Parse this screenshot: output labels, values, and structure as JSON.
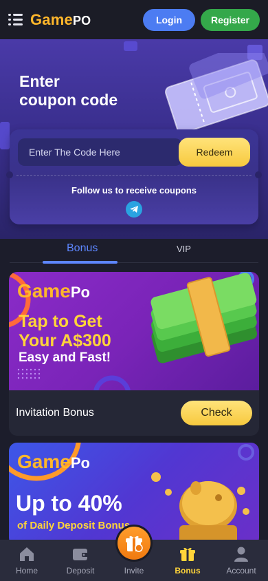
{
  "header": {
    "logo_game": "Game",
    "logo_po": "PO",
    "login_label": "Login",
    "register_label": "Register"
  },
  "hero": {
    "title_line1": "Enter",
    "title_line2": "coupon code"
  },
  "coupon": {
    "placeholder": "Enter The Code Here",
    "redeem_label": "Redeem",
    "follow_text": "Follow us to receive coupons"
  },
  "tabs": [
    {
      "label": "Bonus",
      "active": true
    },
    {
      "label": "VIP",
      "active": false
    }
  ],
  "promos": [
    {
      "logo_game": "Game",
      "logo_po": "Po",
      "line1": "Tap to Get",
      "line2": "Your A$300",
      "line3": "Easy and Fast!",
      "title": "Invitation Bonus",
      "button": "Check"
    },
    {
      "logo_game": "Game",
      "logo_po": "Po",
      "line1": "Up to 40%",
      "line2": "of Daily Deposit Bonus"
    }
  ],
  "nav": [
    {
      "label": "Home",
      "icon": "home-icon"
    },
    {
      "label": "Deposit",
      "icon": "wallet-icon"
    },
    {
      "label": "Invite",
      "icon": "gift-icon"
    },
    {
      "label": "Bonus",
      "icon": "gift-icon",
      "active": true
    },
    {
      "label": "Account",
      "icon": "user-icon"
    }
  ],
  "colors": {
    "brand_orange": "#ffb72b",
    "login_blue": "#4c7cf2",
    "register_green": "#34a84a",
    "accent_yellow": "#ffd43a",
    "tab_active": "#5d86ff"
  }
}
